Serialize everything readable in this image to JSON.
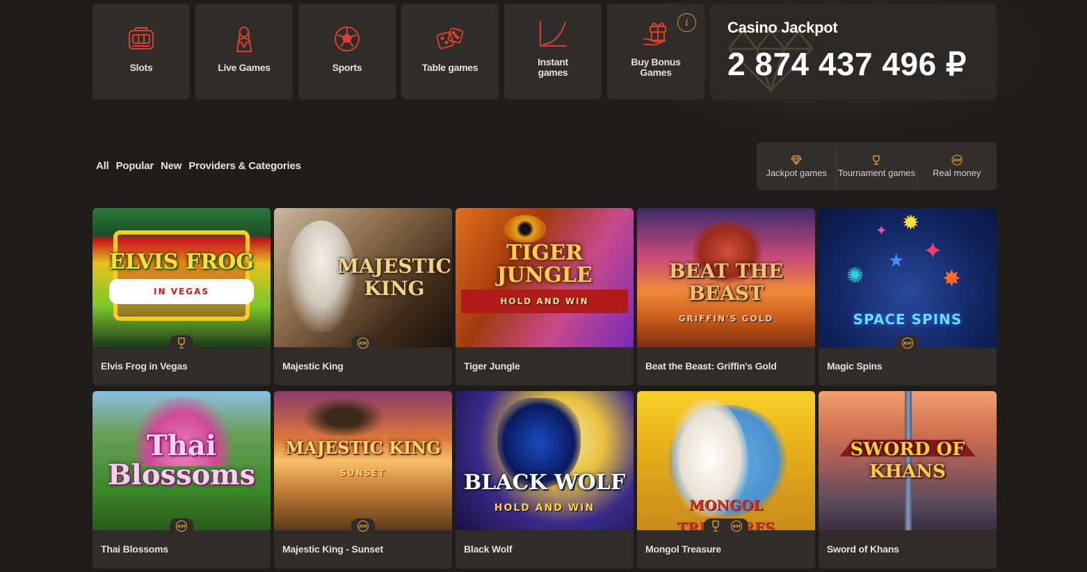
{
  "categories": [
    {
      "label": "Slots",
      "icon": "slot-machine-icon"
    },
    {
      "label": "Live Games",
      "icon": "dealer-icon"
    },
    {
      "label": "Sports",
      "icon": "soccer-ball-icon"
    },
    {
      "label": "Table games",
      "icon": "dice-icon"
    },
    {
      "label": "Instant games",
      "icon": "curve-chart-icon"
    },
    {
      "label": "Buy Bonus Games",
      "icon": "gift-hand-icon",
      "info": "i"
    }
  ],
  "jackpot": {
    "title": "Casino Jackpot",
    "amount": "2 874 437 496 ₽"
  },
  "filters": [
    "All",
    "Popular",
    "New",
    "Providers & Categories"
  ],
  "toggles": [
    {
      "label": "Jackpot games",
      "icon": "diamond-icon"
    },
    {
      "label": "Tournament games",
      "icon": "trophy-icon"
    },
    {
      "label": "Real money",
      "icon": "rm-icon"
    }
  ],
  "games": [
    {
      "title": "Elvis Frog in Vegas",
      "logo": "ELVIS FROG",
      "sub": "IN VEGAS",
      "badges": [
        "trophy"
      ]
    },
    {
      "title": "Majestic King",
      "logo": "MAJESTIC KING",
      "sub": "",
      "badges": [
        "rm"
      ]
    },
    {
      "title": "Tiger Jungle",
      "logo": "TIGER JUNGLE",
      "sub": "HOLD AND WIN",
      "badges": []
    },
    {
      "title": "Beat the Beast: Griffin's Gold",
      "logo": "BEAT THE BEAST",
      "sub": "GRIFFIN'S GOLD",
      "badges": []
    },
    {
      "title": "Magic Spins",
      "logo": "SPACE SPINS",
      "sub": "",
      "badges": [
        "rm"
      ]
    },
    {
      "title": "Thai Blossoms",
      "logo": "Thai Blossoms",
      "sub": "",
      "badges": [
        "rm"
      ]
    },
    {
      "title": "Majestic King - Sunset",
      "logo": "MAJESTIC KING",
      "sub": "SUNSET",
      "badges": [
        "rm"
      ]
    },
    {
      "title": "Black Wolf",
      "logo": "BLACK WOLF",
      "sub": "HOLD AND WIN",
      "badges": []
    },
    {
      "title": "Mongol Treasure",
      "logo": "MONGOL TREASURES",
      "sub": "",
      "badges": [
        "trophy",
        "rm"
      ]
    },
    {
      "title": "Sword of Khans",
      "logo": "SWORD OF KHANS",
      "sub": "",
      "badges": []
    }
  ],
  "colors": {
    "accent": "#d9412e",
    "gold": "#d99a33",
    "tile": "#2f2c2a",
    "background": "#1f1d1c"
  }
}
